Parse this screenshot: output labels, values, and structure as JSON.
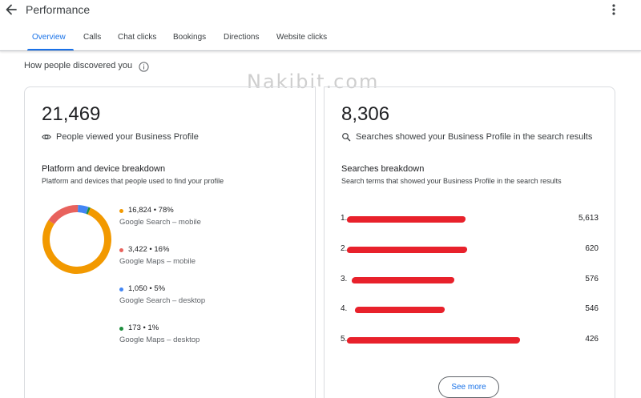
{
  "header": {
    "title": "Performance"
  },
  "tabs": [
    {
      "label": "Overview",
      "active": true
    },
    {
      "label": "Calls"
    },
    {
      "label": "Chat clicks"
    },
    {
      "label": "Bookings"
    },
    {
      "label": "Directions"
    },
    {
      "label": "Website clicks"
    }
  ],
  "section": {
    "title": "How people discovered you"
  },
  "watermark": "Nakibit.com",
  "views": {
    "total": "21,469",
    "label": "People viewed your Business Profile",
    "breakdown_title": "Platform and device breakdown",
    "breakdown_desc": "Platform and devices that people used to find your profile",
    "items": [
      {
        "value": "16,824 • 78%",
        "label": "Google Search – mobile",
        "percent": 78,
        "color": "#f29900"
      },
      {
        "value": "3,422 • 16%",
        "label": "Google Maps – mobile",
        "percent": 16,
        "color": "#e8625d"
      },
      {
        "value": "1,050 • 5%",
        "label": "Google Search – desktop",
        "percent": 5,
        "color": "#4285f4"
      },
      {
        "value": "173 • 1%",
        "label": "Google Maps – desktop",
        "percent": 1,
        "color": "#1e8e3e"
      }
    ]
  },
  "searches": {
    "total": "8,306",
    "label": "Searches showed your Business Profile in the search results",
    "breakdown_title": "Searches breakdown",
    "breakdown_desc": "Search terms that showed your Business Profile in the search results",
    "rows": [
      {
        "num": "1.",
        "count": "5,613"
      },
      {
        "num": "2.",
        "count": "620"
      },
      {
        "num": "3.",
        "count": "576"
      },
      {
        "num": "4.",
        "count": "546"
      },
      {
        "num": "5.",
        "count": "426"
      }
    ],
    "see_more_label": "See more"
  }
}
